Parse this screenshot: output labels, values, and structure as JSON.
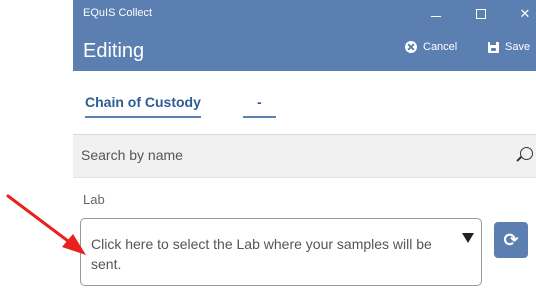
{
  "window": {
    "title": "EQuIS Collect",
    "minimize_glyph": "—",
    "close_glyph": "✕"
  },
  "editbar": {
    "title": "Editing",
    "cancel_label": "Cancel",
    "save_label": "Save"
  },
  "tabs": [
    {
      "label": "Chain of Custody"
    },
    {
      "label": "-"
    }
  ],
  "search": {
    "placeholder": "Search by name"
  },
  "lab": {
    "label": "Lab",
    "prompt": "Click here to select the Lab where your samples will be sent.",
    "refresh_glyph": "⟳"
  },
  "colors": {
    "header": "#5b7fb0",
    "tab_text": "#2e5c94",
    "annotation_arrow": "#e8211c"
  }
}
